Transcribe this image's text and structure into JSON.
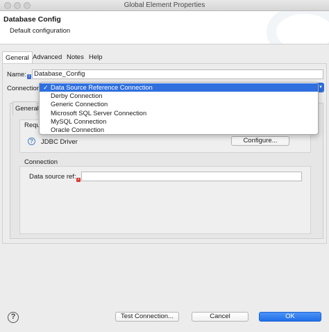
{
  "window": {
    "title": "Global Element Properties"
  },
  "banner": {
    "title": "Database Config",
    "subtitle": "Default configuration"
  },
  "tabs": [
    {
      "label": "General"
    },
    {
      "label": "Advanced"
    },
    {
      "label": "Notes"
    },
    {
      "label": "Help"
    }
  ],
  "form": {
    "name_label": "Name:",
    "name_value": "Database_Config",
    "connection_label": "Connection"
  },
  "inner": {
    "tab_label": "General",
    "required_title": "Requ",
    "jdbc_label": "JDBC Driver",
    "configure_label": "Configure...",
    "connection_title": "Connection",
    "datasource_label": "Data source ref:",
    "datasource_value": ""
  },
  "dropdown": {
    "selected_index": 0,
    "items": [
      {
        "label": "Data Source Reference Connection"
      },
      {
        "label": "Derby Connection"
      },
      {
        "label": "Generic Connection"
      },
      {
        "label": "Microsoft SQL Server Connection"
      },
      {
        "label": "MySQL Connection"
      },
      {
        "label": "Oracle Connection"
      }
    ]
  },
  "footer": {
    "test_label": "Test Connection...",
    "cancel_label": "Cancel",
    "ok_label": "OK"
  },
  "icons": {
    "help": "help-icon",
    "info": "info-icon",
    "error": "error-icon",
    "check": "checkmark-icon"
  },
  "colors": {
    "accent": "#2f6fde",
    "error": "#d8382e"
  }
}
